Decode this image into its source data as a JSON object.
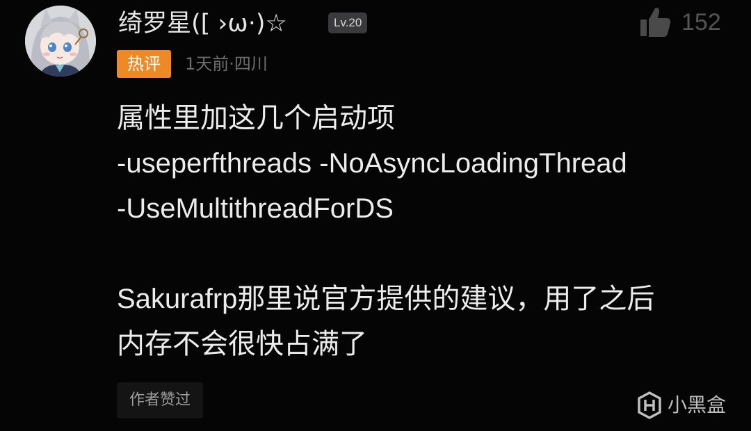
{
  "comment": {
    "author_name": "绮罗星([ ›ω·)☆",
    "level": "Lv.20",
    "hot_label": "热评",
    "time_location": "1天前·四川",
    "like_count": "152",
    "content_lines": [
      "属性里加这几个启动项",
      "-useperfthreads -NoAsyncLoadingThread",
      "-UseMultithreadForDS",
      "",
      "Sakurafrp那里说官方提供的建议，用了之后",
      "内存不会很快占满了"
    ],
    "author_liked_label": "作者赞过"
  },
  "watermark": {
    "brand_text": "小黑盒",
    "logo_icon": "heybox-logo-icon"
  },
  "icons": {
    "like": "thumbs-up-icon",
    "avatar": "anime-avatar"
  },
  "colors": {
    "background": "#050505",
    "hot_badge": "#ee8a26",
    "level_badge": "#3a3a3c",
    "primary_text": "#ececec",
    "muted_text": "#6d6d6d"
  }
}
